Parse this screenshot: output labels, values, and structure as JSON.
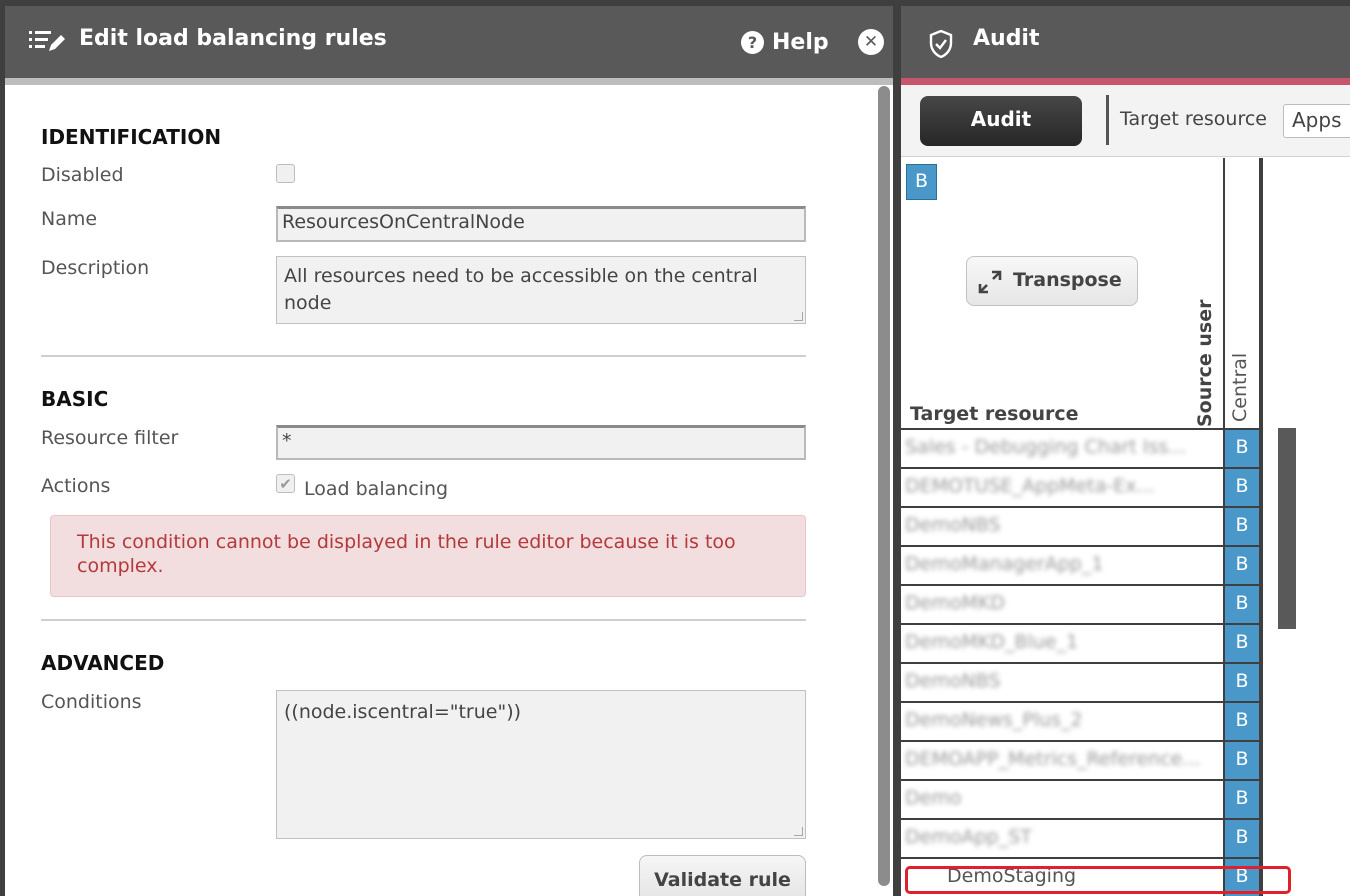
{
  "left_panel": {
    "title": "Edit load balancing rules",
    "help_label": "Help",
    "help_glyph": "?",
    "close_glyph": "✕",
    "identification": {
      "section_title": "IDENTIFICATION",
      "disabled_label": "Disabled",
      "disabled_checked": false,
      "name_label": "Name",
      "name_value": "ResourcesOnCentralNode",
      "description_label": "Description",
      "description_value": "All resources need to be accessible on the central node"
    },
    "basic": {
      "section_title": "BASIC",
      "resource_filter_label": "Resource filter",
      "resource_filter_value": "*",
      "actions_label": "Actions",
      "load_balancing_label": "Load balancing",
      "load_balancing_checked": true,
      "error_message": "This condition cannot be displayed in the rule editor because it is too complex."
    },
    "advanced": {
      "section_title": "ADVANCED",
      "conditions_label": "Conditions",
      "conditions_value": "((node.iscentral=\"true\"))"
    },
    "validate_label": "Validate rule"
  },
  "right_panel": {
    "title": "Audit",
    "audit_button": "Audit",
    "target_resource_label": "Target resource",
    "target_resource_value": "Apps",
    "corner_cell": "B",
    "transpose_label": "Transpose",
    "column_target_resource": "Target resource",
    "column_source_user": "Source user",
    "column_central": "Central",
    "rows": [
      {
        "name": "Sales - Debugging Chart Iss...",
        "cell": "B",
        "obscured": true
      },
      {
        "name": "DEMOTUSE_AppMeta-Ex...",
        "cell": "B",
        "obscured": true
      },
      {
        "name": "DemoNBS",
        "cell": "B",
        "obscured": true
      },
      {
        "name": "DemoManagerApp_1",
        "cell": "B",
        "obscured": true
      },
      {
        "name": "DemoMKD",
        "cell": "B",
        "obscured": true
      },
      {
        "name": "DemoMKD_Blue_1",
        "cell": "B",
        "obscured": true
      },
      {
        "name": "DemoNBS",
        "cell": "B",
        "obscured": true
      },
      {
        "name": "DemoNews_Plus_2",
        "cell": "B",
        "obscured": true
      },
      {
        "name": "DEMOAPP_Metrics_Reference...",
        "cell": "B",
        "obscured": true
      },
      {
        "name": "Demo",
        "cell": "B",
        "obscured": true
      },
      {
        "name": "DemoApp_ST",
        "cell": "B",
        "obscured": true
      },
      {
        "name": "DemoStaging",
        "cell": "B",
        "obscured": false
      }
    ]
  },
  "colors": {
    "header_bg": "#595959",
    "frame": "#3f3f3f",
    "audit_accent": "#c7566b",
    "cell_blue": "#4a98c9",
    "error_text": "#b4393c",
    "error_bg": "#f2dede",
    "highlight_red": "#e0202a"
  },
  "icons": {
    "rules": "edit-list-icon",
    "help": "question-circle-icon",
    "close": "close-circle-icon",
    "audit": "shield-icon",
    "transpose": "expand-arrows-icon"
  }
}
